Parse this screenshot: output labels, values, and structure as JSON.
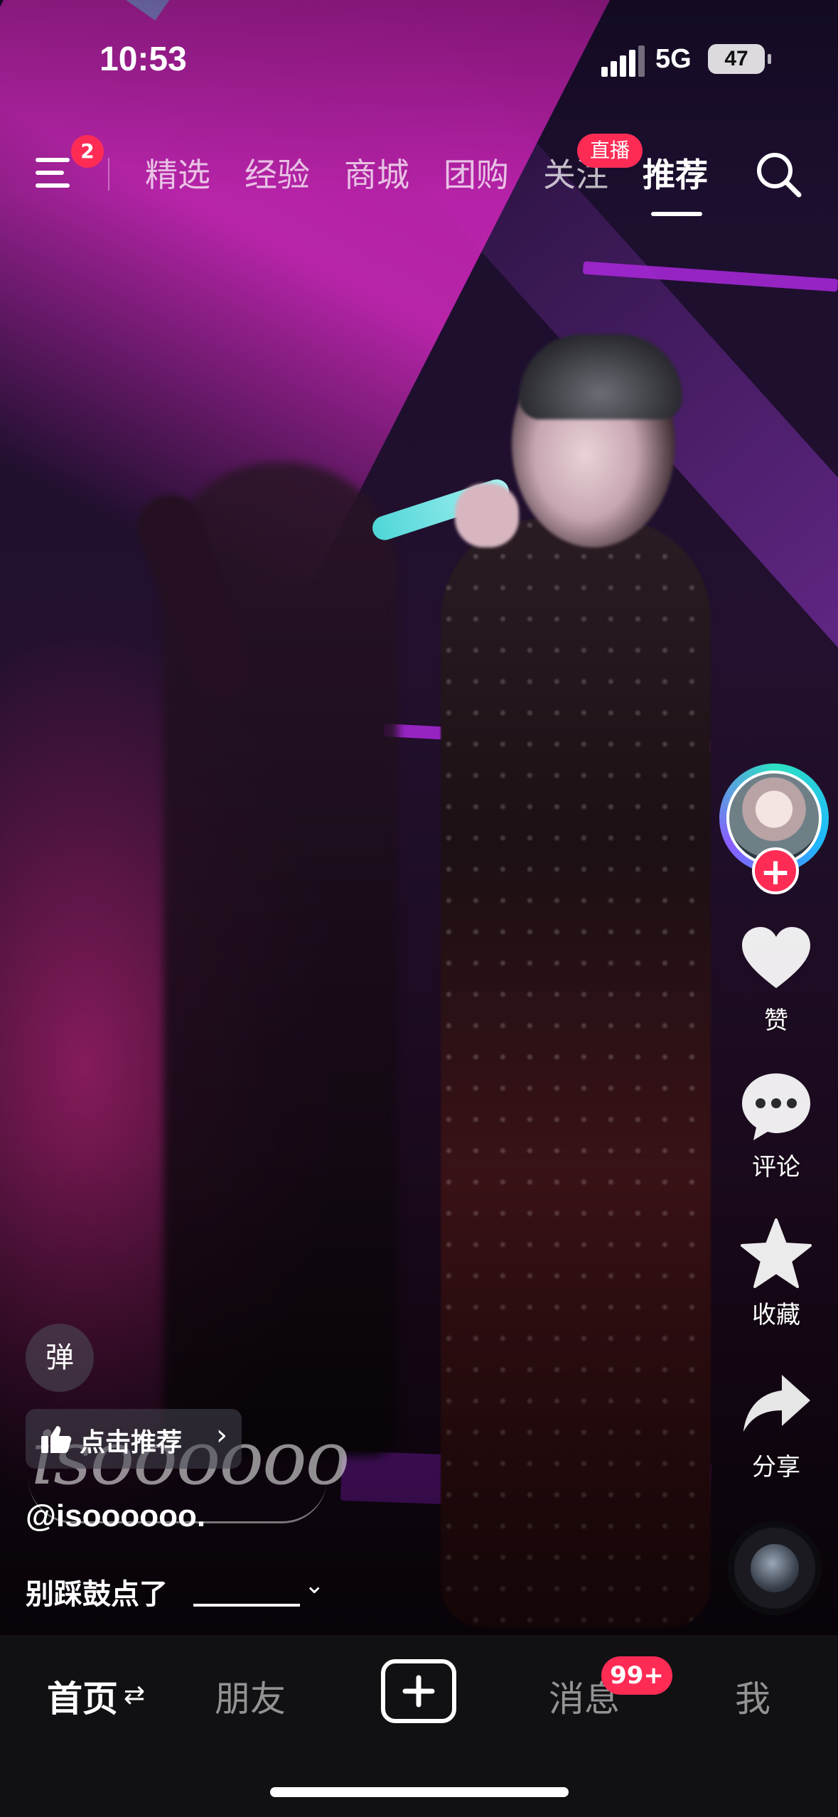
{
  "status_bar": {
    "time": "10:53",
    "network": "5G",
    "battery": "47"
  },
  "top_nav": {
    "menu_badge": "2",
    "tabs": [
      {
        "label": "精选",
        "active": false
      },
      {
        "label": "经验",
        "active": false
      },
      {
        "label": "商城",
        "active": false
      },
      {
        "label": "团购",
        "active": false
      },
      {
        "label": "关注",
        "active": false,
        "badge": "直播"
      },
      {
        "label": "推荐",
        "active": true
      }
    ],
    "search_icon": "search-icon"
  },
  "actions": {
    "follow_icon": "plus",
    "like_label": "赞",
    "comment_label": "评论",
    "favorite_label": "收藏",
    "share_label": "分享"
  },
  "video_info": {
    "danmu_label": "弹",
    "recommend_label": "点击推荐",
    "watermark": "isoooooo",
    "author": "@isoooooo.",
    "caption": "别踩鼓点了"
  },
  "tab_bar": {
    "home": "首页",
    "friends": "朋友",
    "messages": "消息",
    "messages_badge": "99+",
    "me": "我"
  },
  "colors": {
    "accent": "#fe2c55",
    "tab_bar_bg": "#111113"
  }
}
